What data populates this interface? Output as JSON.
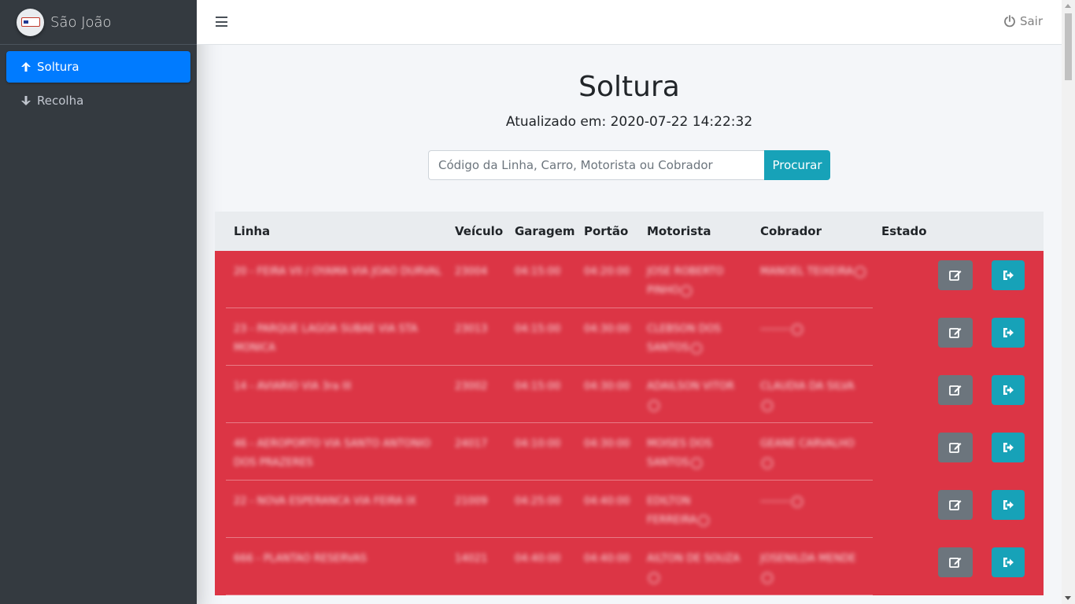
{
  "sidebar": {
    "brand": "São João",
    "items": [
      {
        "label": "Soltura",
        "icon": "arrow-up-icon",
        "active": true
      },
      {
        "label": "Recolha",
        "icon": "arrow-down-icon",
        "active": false
      }
    ]
  },
  "topbar": {
    "logout_label": "Sair"
  },
  "main": {
    "title": "Soltura",
    "updated": "Atualizado em: 2020-07-22 14:22:32",
    "search_placeholder": "Código da Linha, Carro, Motorista ou Cobrador",
    "search_button": "Procurar"
  },
  "table": {
    "headers": [
      "Linha",
      "Veículo",
      "Garagem",
      "Portão",
      "Motorista",
      "Cobrador",
      "Estado"
    ],
    "rows": [
      {
        "linha": "20 - FEIRA VII / OYAMA VIA JOAO DURVAL",
        "veiculo": "23004",
        "garagem": "04:15:00",
        "portao": "04:20:00",
        "motorista": "JOSE ROBERTO PINHO",
        "cobrador": "MANOEL TEIXEIRA"
      },
      {
        "linha": "23 - PARQUE LAGOA SUBAE VIA STA MONICA",
        "veiculo": "23013",
        "garagem": "04:15:00",
        "portao": "04:30:00",
        "motorista": "CLEBSON DOS SANTOS",
        "cobrador": "--------"
      },
      {
        "linha": "14 - AVIARIO VIA 3ra III",
        "veiculo": "23002",
        "garagem": "04:15:00",
        "portao": "04:30:00",
        "motorista": "ADAILSON VITOR",
        "cobrador": "CLAUDIA DA SILVA"
      },
      {
        "linha": "46 - AEROPORTO VIA SANTO ANTONIO DOS PRAZERES",
        "veiculo": "24017",
        "garagem": "04:10:00",
        "portao": "04:30:00",
        "motorista": "MOISES DOS SANTOS",
        "cobrador": "GEANE CARVALHO"
      },
      {
        "linha": "22 - NOVA ESPERANCA VIA FEIRA IX",
        "veiculo": "21009",
        "garagem": "04:25:00",
        "portao": "04:40:00",
        "motorista": "EDILTON FERREIRA",
        "cobrador": "--------"
      },
      {
        "linha": "666 - PLANTAO RESERVAS",
        "veiculo": "14021",
        "garagem": "04:40:00",
        "portao": "04:40:00",
        "motorista": "AILTON DE SOUZA",
        "cobrador": "JOSENILDA MENDE"
      }
    ]
  },
  "colors": {
    "sidebar_bg": "#343a40",
    "active_nav": "#007bff",
    "row_danger": "#dc3545",
    "info": "#17a2b8",
    "secondary": "#6c757d"
  }
}
